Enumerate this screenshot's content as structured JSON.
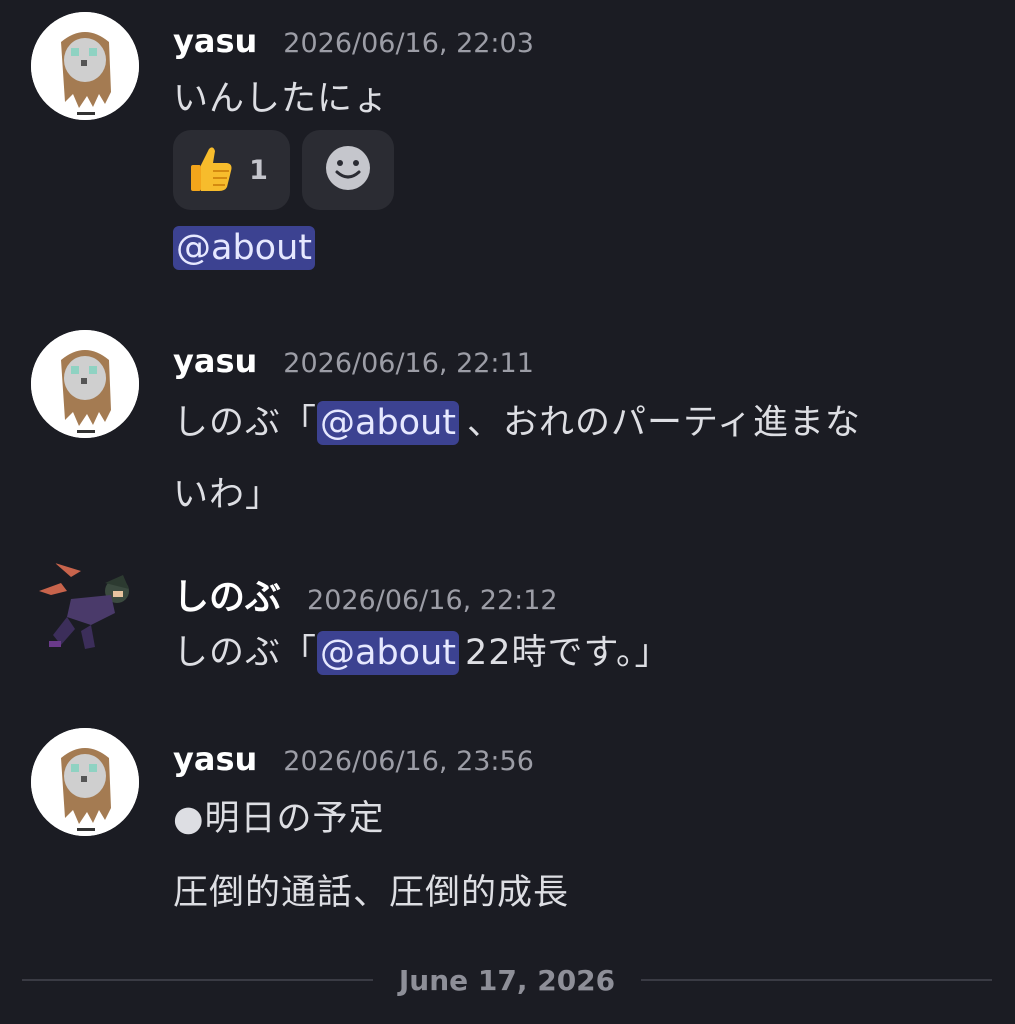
{
  "messages": [
    {
      "author": "yasu",
      "timestamp": "2026/06/16, 22:03",
      "lines": [
        "いんしたにょ"
      ],
      "reactions": [
        {
          "emoji": "thumbs-up",
          "count": "1"
        },
        {
          "emoji": "add-reaction"
        }
      ],
      "mention_line": "@about"
    },
    {
      "author": "yasu",
      "timestamp": "2026/06/16, 22:11",
      "line1_prefix": "しのぶ「",
      "line1_mention": "@about",
      "line1_suffix": "、おれのパーティ進まな",
      "line2": "いわ」"
    },
    {
      "author": "しのぶ",
      "timestamp": "2026/06/16, 22:12",
      "line1_prefix": "しのぶ「",
      "line1_mention": "@about",
      "line1_suffix": "22時です。」"
    },
    {
      "author": "yasu",
      "timestamp": "2026/06/16, 23:56",
      "lines": [
        "●明日の予定",
        "圧倒的通話、圧倒的成長"
      ]
    }
  ],
  "date_divider": "June 17, 2026",
  "colors": {
    "background": "#1b1c23",
    "mention_bg": "#3c4291",
    "reaction_bg": "#2b2c33"
  }
}
